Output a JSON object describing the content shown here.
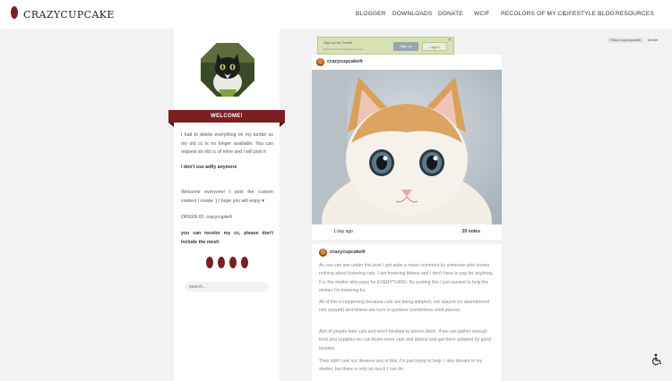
{
  "header": {
    "logo_text": "CRAZYCUPCAKE",
    "nav": [
      {
        "label": "BLOGGER"
      },
      {
        "label": "DOWNLOADS"
      },
      {
        "label": "DONATE"
      },
      {
        "label": "WCIF"
      },
      {
        "label": "RECOLORS OF MY CC"
      },
      {
        "label": "LIFESTYLE BLOG"
      },
      {
        "label": "RESOURCES"
      }
    ]
  },
  "sidebar": {
    "welcome": "WELCOME!",
    "para1": "I had to delete everything on my tumblr so my old cc is no longer available. You can request an old cc of mine and I will post it",
    "para2": "I don't use adfly anymore",
    "para3": "Welcome everyone! I post the custom content I create :) I hope you will enjoy ♥",
    "para4": "ORIGIN ID: crazycupkefr",
    "para5": "you can recolor my cc, please don't include the mesh",
    "search_placeholder": "search..."
  },
  "tumblr_bar": {
    "title": "Sign up for Tumblr",
    "subtitle": "Discover more blogs like this one.",
    "signup": "Sign up",
    "login": "Log in",
    "close": "✕",
    "follow": "Follow crazycupcakefr",
    "tumblr_link": "tumblr"
  },
  "posts": [
    {
      "user": "crazycupcakefr",
      "time": "1 day ago",
      "notes": "20 notes"
    },
    {
      "user": "crazycupcakefr",
      "paragraphs": [
        "As you can see under this post I got quite a mean comment by someone who knows nothing about fostering cats. I am fostering kittens and I don't have to pay for anything. It is the shelter who pays for EVERYTHING. By posting this I just wanted to help the shelter I'm fostering for.",
        "All of this is happening because cats are being adopted, not spayed (or abandonned non spayed) and kittens are born in gardens (sometimes wind places)",
        "Alot of people hate cats and won't hesitate to poison them. If we can gather enough food and supplies we can foster more cats and kittens and get them adopted by good families.",
        "They didn't ask nor deserve any of this. I'm just trying to help. I also donate to my shelter, but there is only so much I can do."
      ]
    }
  ],
  "colors": {
    "accent": "#7a1f22",
    "background": "#f2f2f2",
    "popup": "#d7e2b4"
  },
  "icons": [
    "cat-avatar-icon",
    "close-icon",
    "accessibility-icon"
  ]
}
